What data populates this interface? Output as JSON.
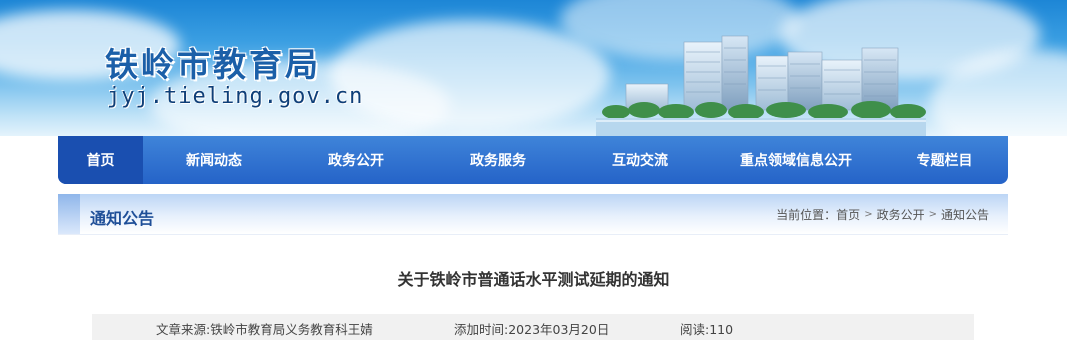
{
  "header": {
    "site_name": "铁岭市教育局",
    "domain": "jyj.tieling.gov.cn"
  },
  "nav": {
    "items": [
      {
        "label": "首页",
        "active": true
      },
      {
        "label": "新闻动态"
      },
      {
        "label": "政务公开"
      },
      {
        "label": "政务服务"
      },
      {
        "label": "互动交流"
      },
      {
        "label": "重点领域信息公开"
      },
      {
        "label": "专题栏目"
      }
    ]
  },
  "section": {
    "title": "通知公告",
    "breadcrumb_prefix": "当前位置：",
    "breadcrumb": [
      "首页",
      "政务公开",
      "通知公告"
    ],
    "separator_icon": "chevron-right-icon"
  },
  "article": {
    "title": "关于铁岭市普通话水平测试延期的通知",
    "source": "文章来源:铁岭市教育局义务教育科王婧",
    "date": "添加时间:2023年03月20日",
    "views": "阅读:110"
  },
  "colors": {
    "nav_bg": "#2563c8",
    "nav_active": "#1a4fb0",
    "section_title": "#1f4f98",
    "site_name": "#1b5fa8"
  }
}
